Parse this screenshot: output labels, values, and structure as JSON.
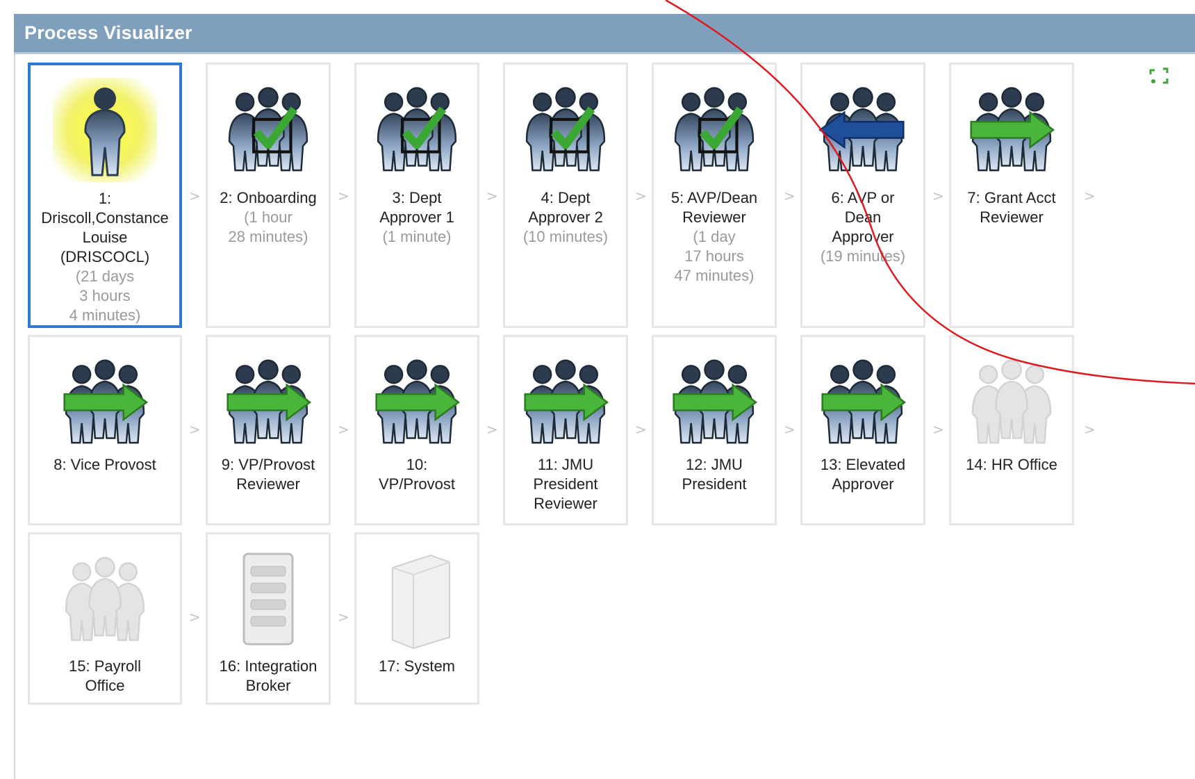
{
  "header": {
    "title": "Process Visualizer"
  },
  "separator": ">",
  "steps": [
    {
      "label": "1:\nDriscoll,Constance\nLouise\n(DRISCOCL)",
      "duration": "(21 days\n3 hours\n4 minutes)",
      "icon": "person-highlighted-icon",
      "active": true
    },
    {
      "label": "2: Onboarding",
      "duration": "(1 hour\n28 minutes)",
      "icon": "group-check-icon"
    },
    {
      "label": "3: Dept\nApprover 1",
      "duration": "(1 minute)",
      "icon": "group-check-icon"
    },
    {
      "label": "4: Dept\nApprover 2",
      "duration": "(10 minutes)",
      "icon": "group-check-icon"
    },
    {
      "label": "5: AVP/Dean\nReviewer",
      "duration": "(1 day\n17 hours\n47 minutes)",
      "icon": "group-check-icon"
    },
    {
      "label": "6: AVP or\nDean\nApprover",
      "duration": "(19 minutes)",
      "icon": "group-back-arrow-icon"
    },
    {
      "label": "7: Grant Acct\nReviewer",
      "duration": "",
      "icon": "group-forward-arrow-icon"
    },
    {
      "label": "8: Vice Provost",
      "duration": "",
      "icon": "group-forward-arrow-icon"
    },
    {
      "label": "9: VP/Provost\nReviewer",
      "duration": "",
      "icon": "group-forward-arrow-icon"
    },
    {
      "label": "10:\nVP/Provost",
      "duration": "",
      "icon": "group-forward-arrow-icon"
    },
    {
      "label": "11: JMU\nPresident\nReviewer",
      "duration": "",
      "icon": "group-forward-arrow-icon"
    },
    {
      "label": "12: JMU\nPresident",
      "duration": "",
      "icon": "group-forward-arrow-icon"
    },
    {
      "label": "13: Elevated\nApprover",
      "duration": "",
      "icon": "group-forward-arrow-icon"
    },
    {
      "label": "14: HR Office",
      "duration": "",
      "icon": "group-inactive-icon"
    },
    {
      "label": "15: Payroll\nOffice",
      "duration": "",
      "icon": "group-inactive-icon"
    },
    {
      "label": "16: Integration\nBroker",
      "duration": "",
      "icon": "integration-broker-icon"
    },
    {
      "label": "17: System",
      "duration": "",
      "icon": "server-tower-icon"
    }
  ],
  "colors": {
    "header_bg": "#7f9fbd",
    "active_border": "#2e78d6",
    "check_green": "#3aa832",
    "arrow_green": "#49b53b",
    "back_arrow_blue": "#1f4f9a",
    "annotation_red": "#e0191e"
  }
}
